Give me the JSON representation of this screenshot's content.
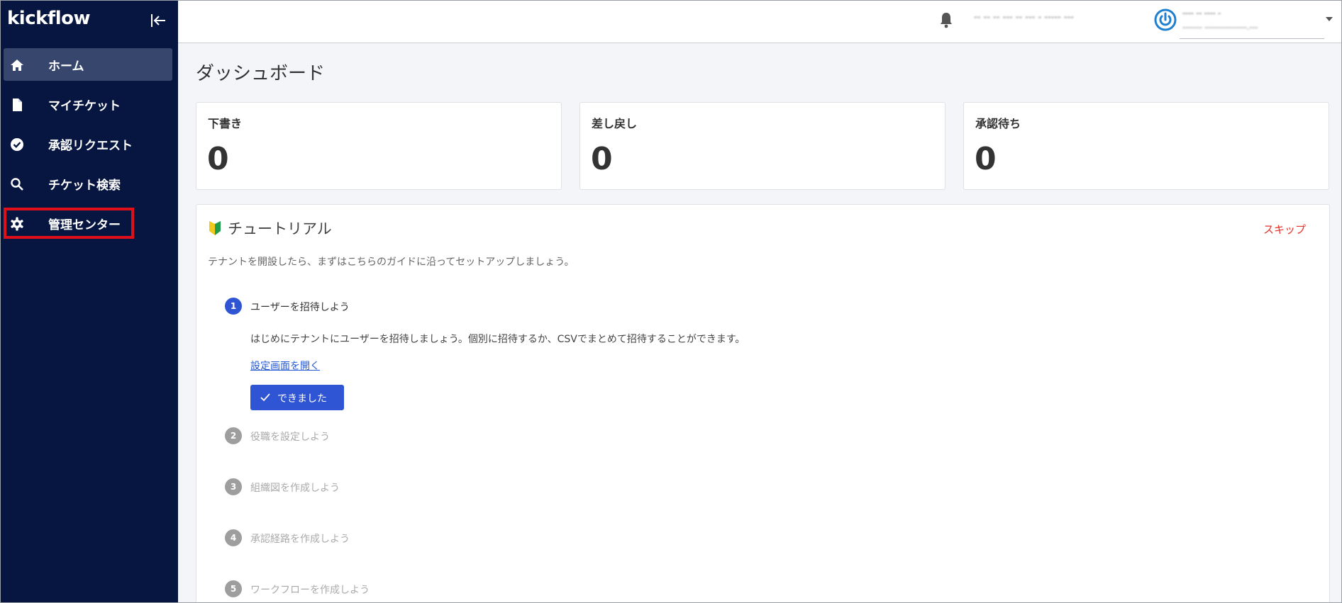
{
  "app": {
    "brand": "kickflow"
  },
  "colors": {
    "sidebar_bg": "#061640",
    "active_item_bg": "#37466c",
    "primary": "#2f55d4",
    "skip_red": "#e5312c",
    "highlight_red": "#e0101a"
  },
  "sidebar": {
    "collapse_icon": "collapse-left-icon",
    "items": [
      {
        "label": "ホーム",
        "icon": "home-icon",
        "active": true
      },
      {
        "label": "マイチケット",
        "icon": "document-icon",
        "active": false
      },
      {
        "label": "承認リクエスト",
        "icon": "check-circle-icon",
        "active": false
      },
      {
        "label": "チケット検索",
        "icon": "search-icon",
        "active": false
      },
      {
        "label": "管理センター",
        "icon": "gear-icon",
        "active": false,
        "highlighted": true
      }
    ]
  },
  "header": {
    "notification_icon": "bell-icon",
    "tenant_name": "-- -- -- --- -- --- - ----- ---",
    "user": {
      "name": "---- -- ---- -",
      "email": "------- ---------------.---"
    }
  },
  "main": {
    "title": "ダッシュボード",
    "stats": [
      {
        "label": "下書き",
        "value": "0"
      },
      {
        "label": "差し戻し",
        "value": "0"
      },
      {
        "label": "承認待ち",
        "value": "0"
      }
    ],
    "tutorial": {
      "title": "チュートリアル",
      "icon": "beginner-mark-icon",
      "skip_label": "スキップ",
      "description": "テナントを開設したら、まずはこちらのガイドに沿ってセットアップしましょう。",
      "steps": [
        {
          "number": "1",
          "title": "ユーザーを招待しよう",
          "active": true,
          "description": "はじめにテナントにユーザーを招待しましょう。個別に招待するか、CSVでまとめて招待することができます。",
          "link_label": "設定画面を開く",
          "button_label": "できました"
        },
        {
          "number": "2",
          "title": "役職を設定しよう",
          "active": false
        },
        {
          "number": "3",
          "title": "組織図を作成しよう",
          "active": false
        },
        {
          "number": "4",
          "title": "承認経路を作成しよう",
          "active": false
        },
        {
          "number": "5",
          "title": "ワークフローを作成しよう",
          "active": false
        }
      ]
    }
  }
}
